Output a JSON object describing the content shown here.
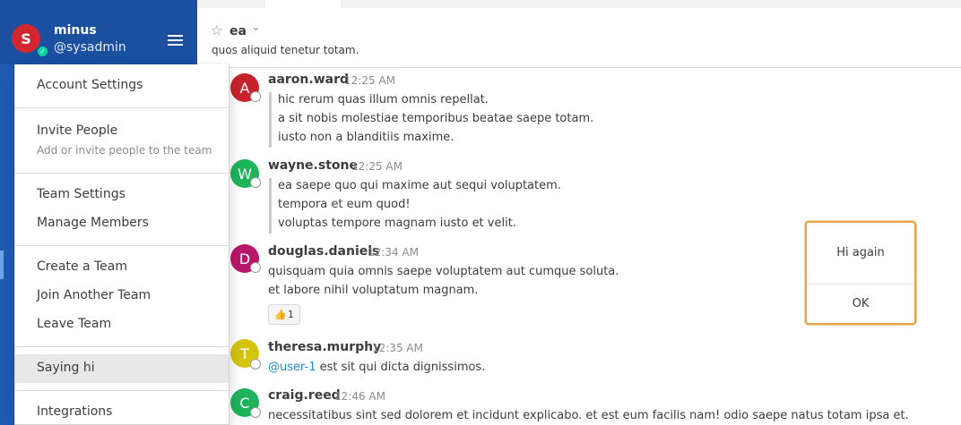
{
  "sidebar": {
    "avatar_initial": "S",
    "username": "minus",
    "handle": "@sysadmin",
    "status_icon": "check-icon"
  },
  "channel": {
    "name": "ea",
    "purpose": "quos aliquid tenetur totam."
  },
  "menu": {
    "account_settings": "Account Settings",
    "invite_people": "Invite People",
    "invite_people_sub": "Add or invite people to the team",
    "team_settings": "Team Settings",
    "manage_members": "Manage Members",
    "create_team": "Create a Team",
    "join_team": "Join Another Team",
    "leave_team": "Leave Team",
    "saying_hi": "Saying hi",
    "integrations": "Integrations"
  },
  "posts": [
    {
      "initial": "A",
      "color": "#c8232c",
      "user": "aaron.ward",
      "time": "12:25 AM",
      "lines": [
        "hic rerum quas illum omnis repellat.",
        "a sit nobis molestiae temporibus beatae saepe totam.",
        "iusto non a blanditiis maxime."
      ]
    },
    {
      "initial": "W",
      "color": "#1fb35c",
      "user": "wayne.stone",
      "time": "12:25 AM",
      "lines": [
        "ea saepe quo qui maxime aut sequi voluptatem.",
        "tempora et eum quod!",
        "voluptas tempore magnam iusto et velit."
      ]
    },
    {
      "initial": "D",
      "color": "#b7176a",
      "user": "douglas.daniels",
      "time": "12:34 AM",
      "lines": [
        "quisquam quia omnis saepe voluptatem aut cumque soluta.",
        "et labore nihil voluptatum magnam."
      ],
      "reaction": {
        "emoji": "👍",
        "count": "1"
      }
    },
    {
      "initial": "T",
      "color": "#d4c40e",
      "user": "theresa.murphy",
      "time": "12:35 AM",
      "mention": "@user-1",
      "lines": [
        " est sit qui dicta dignissimos."
      ]
    },
    {
      "initial": "C",
      "color": "#1fb35c",
      "user": "craig.reed",
      "time": "12:46 AM",
      "lines": [
        "necessitatibus sint sed dolorem et incidunt explicabo. et est eum facilis nam! odio saepe natus totam ipsa et."
      ]
    }
  ],
  "dialog": {
    "message": "Hi again",
    "ok": "OK"
  }
}
